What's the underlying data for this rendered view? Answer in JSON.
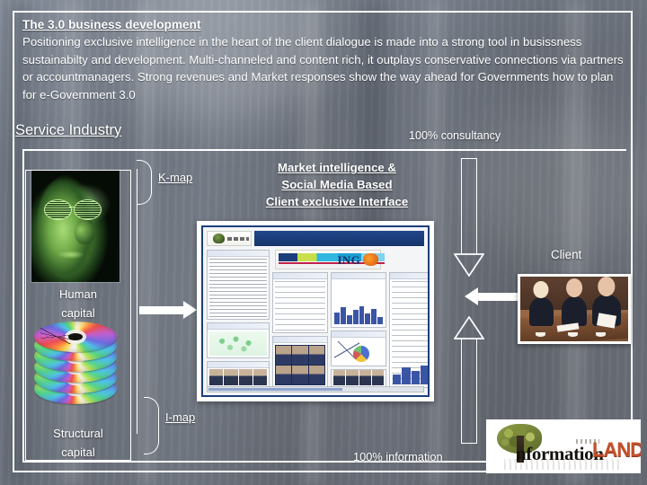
{
  "header": {
    "title": "The 3.0 business development",
    "body": "Positioning exclusive intelligence in the heart of the client dialogue is made into a strong tool in busissness sustainabilty and development. Multi-channeled and content rich, it outplays conservative connections via partners or accountmanagers. Strong revenues and Market responses show the way ahead for Governments how to plan for e-Government 3.0"
  },
  "sections": {
    "service_industry": "Service Industry"
  },
  "center_heading": {
    "line1": "Market intelligence &",
    "line2": "Social Media Based",
    "line3": "Client exclusive Interface"
  },
  "labels": {
    "consultancy": "100% consultancy",
    "information": "100% information",
    "client": "Client",
    "k_map": "K-map",
    "i_map": "I-map",
    "human_capital_line1": "Human",
    "human_capital_line2": "capital",
    "structural_capital_line1": "Structural",
    "structural_capital_line2": "capital"
  },
  "images": {
    "face": "matrix-face-photo",
    "cds": "cd-stack-photo",
    "dashboard": "dashboard-screenshot",
    "meeting": "business-meeting-photo",
    "logo": "informationland-logo"
  },
  "logo": {
    "word": "nformation",
    "land": "LAND"
  },
  "dashboard": {
    "brand": "ING"
  },
  "colors": {
    "background": "#6a6f78",
    "frame": "#ffffff",
    "text": "#ffffff",
    "logo_accent": "#c4502a",
    "dashboard_blue": "#1b3f7a"
  }
}
